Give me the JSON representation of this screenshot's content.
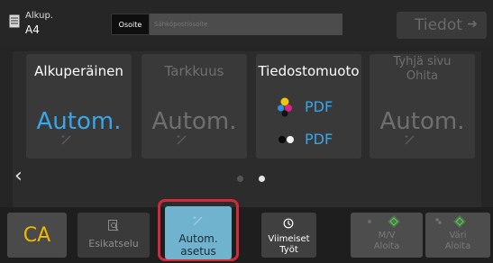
{
  "header": {
    "original_label": "Alkup.",
    "original_size": "A4",
    "address_button": "Osoite",
    "email_placeholder": "Sähköpostiosoite",
    "details_button": "Tiedot"
  },
  "tiles": [
    {
      "title": "Alkuperäinen",
      "value": "Autom.",
      "active": true
    },
    {
      "title": "Tarkkuus",
      "value": "Autom.",
      "active": false
    },
    {
      "title": "Tiedostomuoto",
      "formats": [
        "PDF",
        "PDF"
      ]
    },
    {
      "title_line1": "Tyhjä sivu",
      "title_line2": "Ohita",
      "value": "Autom.",
      "active": false
    }
  ],
  "pager": {
    "page_count": 2,
    "current": 2
  },
  "bottom": {
    "ca_label": "CA",
    "preview_label": "Esikatselu",
    "auto_line1": "Autom.",
    "auto_line2": "asetus",
    "recent_line1": "Viimeiset",
    "recent_line2": "Työt",
    "mv_line1": "M/V",
    "mv_line2": "Aloita",
    "color_line1": "Väri",
    "color_line2": "Aloita"
  },
  "colors": {
    "accent_blue": "#3aa6e8",
    "ca_yellow": "#f0b800",
    "highlight_red": "#d32a3b",
    "auto_button": "#6fb3cf",
    "start_green": "#3fa83f"
  }
}
